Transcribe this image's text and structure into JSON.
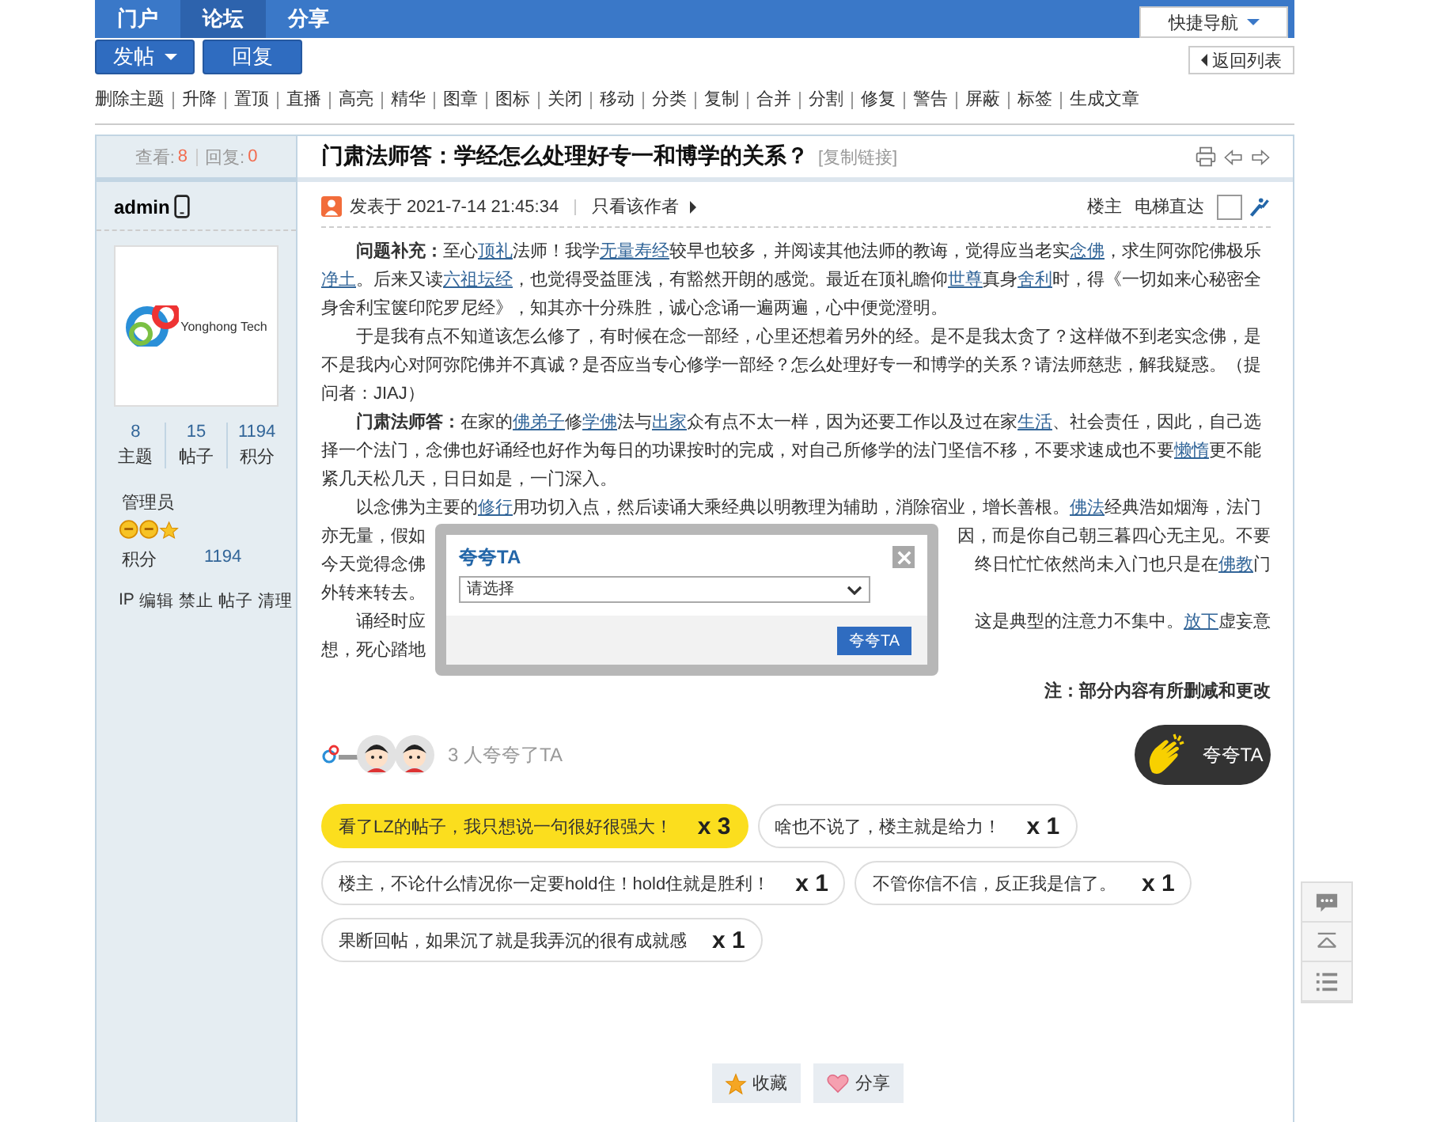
{
  "nav": {
    "items": [
      {
        "label": "门户",
        "selected": false
      },
      {
        "label": "论坛",
        "selected": true
      },
      {
        "label": "分享",
        "selected": false
      }
    ],
    "quick_nav": "快捷导航"
  },
  "actions": {
    "post": "发帖",
    "reply": "回复",
    "back": "返回列表"
  },
  "mod_links": [
    "删除主题",
    "升降",
    "置顶",
    "直播",
    "高亮",
    "精华",
    "图章",
    "图标",
    "关闭",
    "移动",
    "分类",
    "复制",
    "合并",
    "分割",
    "修复",
    "警告",
    "屏蔽",
    "标签",
    "生成文章"
  ],
  "sidebar": {
    "views_label": "查看:",
    "views": "8",
    "replies_label": "回复:",
    "replies": "0",
    "username": "admin",
    "stats": [
      {
        "value": "8",
        "label": "主题"
      },
      {
        "value": "15",
        "label": "帖子"
      },
      {
        "value": "1194",
        "label": "积分"
      }
    ],
    "avatar_text": "Yonghong Tech",
    "group": "管理员",
    "points_label": "积分",
    "points": "1194",
    "admin_links": [
      "IP",
      "编辑",
      "禁止",
      "帖子",
      "清理"
    ]
  },
  "post": {
    "title": "门肃法师答：学经怎么处理好专一和博学的关系？",
    "copy_link": "[复制链接]",
    "posted": "发表于 2021-7-14 21:45:34",
    "only_author": "只看该作者",
    "floor": "楼主",
    "jump": "电梯直达",
    "paragraphs": [
      {
        "kind": "flow",
        "segments": [
          {
            "kind": "label",
            "text": "问题补充："
          },
          {
            "kind": "text",
            "text": "至心"
          },
          {
            "kind": "link",
            "text": "顶礼"
          },
          {
            "kind": "text",
            "text": "法师！我学"
          },
          {
            "kind": "link",
            "text": "无量寿经"
          },
          {
            "kind": "text",
            "text": "较早也较多，并阅读其他法师的教诲，觉得应当老实"
          },
          {
            "kind": "link",
            "text": "念佛"
          },
          {
            "kind": "text",
            "text": "，求生阿弥陀佛极乐"
          },
          {
            "kind": "link",
            "text": "净土"
          },
          {
            "kind": "text",
            "text": "。后来又读"
          },
          {
            "kind": "link",
            "text": "六祖坛经"
          },
          {
            "kind": "text",
            "text": "，也觉得受益匪浅，有豁然开朗的感觉。最近在顶礼瞻仰"
          },
          {
            "kind": "link",
            "text": "世尊"
          },
          {
            "kind": "text",
            "text": "真身"
          },
          {
            "kind": "link",
            "text": "舍利"
          },
          {
            "kind": "text",
            "text": "时，得《一切如来心秘密全身舍利宝箧印陀罗尼经》，知其亦十分殊胜，诚心念诵一遍两遍，心中便觉澄明。"
          }
        ]
      },
      {
        "kind": "flow",
        "segments": [
          {
            "kind": "text",
            "text": "于是我有点不知道该怎么修了，有时候在念一部经，心里还想着另外的经。是不是我太贪了？这样做不到老实念佛，是不是我内心对阿弥陀佛并不真诚？是否应当专心修学一部经？怎么处理好专一和博学的关系？请法师慈悲，解我疑惑。（提问者：JIAJ）"
          }
        ]
      },
      {
        "kind": "flow",
        "segments": [
          {
            "kind": "label",
            "text": "门肃法师答："
          },
          {
            "kind": "text",
            "text": "在家的"
          },
          {
            "kind": "link",
            "text": "佛弟子"
          },
          {
            "kind": "text",
            "text": "修"
          },
          {
            "kind": "link",
            "text": "学佛"
          },
          {
            "kind": "text",
            "text": "法与"
          },
          {
            "kind": "link",
            "text": "出家"
          },
          {
            "kind": "text",
            "text": "众有点不太一样，因为还要工作以及过在家"
          },
          {
            "kind": "link",
            "text": "生活"
          },
          {
            "kind": "text",
            "text": "、社会责任，因此，自己选择一个法门，念佛也好诵经也好作为每日的功课按时的完成，对自己所修学的法门坚信不移，不要求速成也不要"
          },
          {
            "kind": "link",
            "text": "懒惰"
          },
          {
            "kind": "text",
            "text": "更不能紧几天松几天，日日如是，一门深入。"
          }
        ]
      },
      {
        "kind": "split",
        "lines": [
          {
            "left": [
              {
                "kind": "text",
                "text": "以念佛为主要的"
              },
              {
                "kind": "link",
                "text": "修行"
              },
              {
                "kind": "text",
                "text": "用功切入点，然后读诵大乘经典以明教理为辅助，消除宿业，增长善根。"
              },
              {
                "kind": "link",
                "text": "佛法"
              },
              {
                "kind": "text",
                "text": "经典浩如烟海，法门"
              }
            ]
          },
          {
            "left": [
              {
                "kind": "text",
                "text": "亦无量，假如"
              }
            ],
            "right": [
              {
                "kind": "text",
                "text": "因，而是你自己朝三暮四心无主见。不要"
              }
            ]
          },
          {
            "left": [
              {
                "kind": "text",
                "text": "今天觉得念佛"
              }
            ],
            "right": [
              {
                "kind": "text",
                "text": "终日忙忙依然尚未入门也只是在"
              },
              {
                "kind": "link",
                "text": "佛教"
              },
              {
                "kind": "text",
                "text": "门"
              }
            ]
          },
          {
            "left": [
              {
                "kind": "text",
                "text": "外转来转去。"
              }
            ]
          }
        ]
      },
      {
        "kind": "split",
        "lines": [
          {
            "left": [
              {
                "kind": "text",
                "text": "诵经时应"
              }
            ],
            "right": [
              {
                "kind": "text",
                "text": "这是典型的注意力不集中。"
              },
              {
                "kind": "link",
                "text": "放下"
              },
              {
                "kind": "text",
                "text": "虚妄意"
              }
            ]
          },
          {
            "left": [
              {
                "kind": "text",
                "text": "想，死心踏地"
              }
            ]
          }
        ]
      }
    ],
    "note": "注：部分内容有所删减和更改"
  },
  "kudos": {
    "count_text": "3 人夸夸了TA",
    "button": "夸夸TA",
    "tags": [
      {
        "text": "看了LZ的帖子，我只想说一句很好很强大！",
        "count": "x 3",
        "selected": true
      },
      {
        "text": "啥也不说了，楼主就是给力！",
        "count": "x 1",
        "selected": false
      },
      {
        "text": "楼主，不论什么情况你一定要hold住！hold住就是胜利！",
        "count": "x 1",
        "selected": false
      },
      {
        "text": "不管你信不信，反正我是信了。",
        "count": "x 1",
        "selected": false
      },
      {
        "text": "果断回帖，如果沉了就是我弄沉的很有成就感",
        "count": "x 1",
        "selected": false
      }
    ]
  },
  "bottom": {
    "favorite": "收藏",
    "share": "分享"
  },
  "dialog": {
    "title": "夸夸TA",
    "select_placeholder": "请选择",
    "submit": "夸夸TA"
  }
}
